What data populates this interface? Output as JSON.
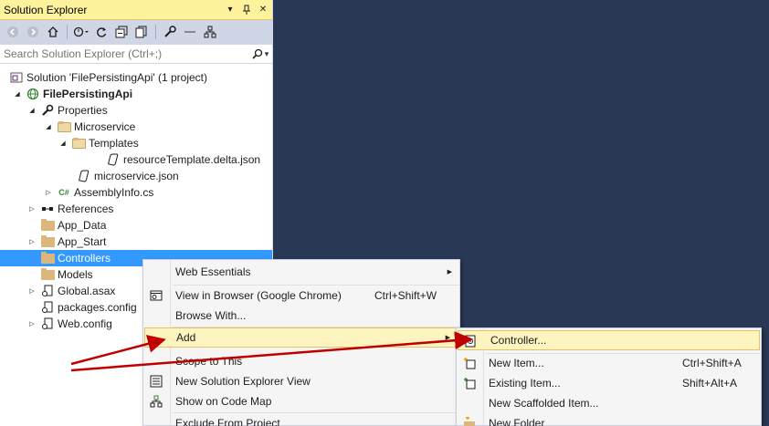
{
  "solution_explorer": {
    "title": "Solution Explorer",
    "title_buttons": [
      "dropdown-icon",
      "pin-icon",
      "close-icon"
    ],
    "toolbar_icons": [
      "back-icon",
      "forward-icon",
      "home-icon",
      "sync-history-icon",
      "refresh-icon",
      "collapse-all-icon",
      "show-all-files-icon",
      "properties-icon",
      "preview-icon",
      "code-map-icon"
    ],
    "search": {
      "placeholder": "Search Solution Explorer (Ctrl+;)"
    },
    "tree": [
      {
        "label": "Solution 'FilePersistingApi' (1 project)",
        "icon": "solution-icon",
        "expander": ""
      },
      {
        "label": "FilePersistingApi",
        "icon": "web-project-icon",
        "expander": "expanded",
        "bold": true
      },
      {
        "label": "Properties",
        "icon": "wrench-icon",
        "expander": "expanded"
      },
      {
        "label": "Microservice",
        "icon": "folder-open-icon",
        "expander": "expanded"
      },
      {
        "label": "Templates",
        "icon": "folder-open-icon",
        "expander": "expanded"
      },
      {
        "label": "resourceTemplate.delta.json",
        "icon": "json-file-icon",
        "expander": ""
      },
      {
        "label": "microservice.json",
        "icon": "json-file-icon",
        "expander": ""
      },
      {
        "label": "AssemblyInfo.cs",
        "icon": "csharp-file-icon",
        "expander": "collapsed"
      },
      {
        "label": "References",
        "icon": "references-icon",
        "expander": "collapsed"
      },
      {
        "label": "App_Data",
        "icon": "folder-icon",
        "expander": ""
      },
      {
        "label": "App_Start",
        "icon": "folder-icon",
        "expander": "collapsed"
      },
      {
        "label": "Controllers",
        "icon": "folder-icon",
        "expander": "",
        "selected": true
      },
      {
        "label": "Models",
        "icon": "folder-icon",
        "expander": ""
      },
      {
        "label": "Global.asax",
        "icon": "config-file-icon",
        "expander": "collapsed"
      },
      {
        "label": "packages.config",
        "icon": "config-file-icon",
        "expander": ""
      },
      {
        "label": "Web.config",
        "icon": "config-file-icon",
        "expander": "collapsed"
      }
    ]
  },
  "context_menu": {
    "items": [
      {
        "label": "Web Essentials",
        "shortcut": "",
        "submenu": true,
        "icon": ""
      },
      {
        "label": "View in Browser (Google Chrome)",
        "shortcut": "Ctrl+Shift+W",
        "submenu": false,
        "icon": "browser-icon"
      },
      {
        "label": "Browse With...",
        "shortcut": "",
        "submenu": false,
        "icon": ""
      },
      {
        "label": "Add",
        "shortcut": "",
        "submenu": true,
        "icon": "",
        "highlighted": true
      },
      {
        "label": "Scope to This",
        "shortcut": "",
        "submenu": false,
        "icon": ""
      },
      {
        "label": "New Solution Explorer View",
        "shortcut": "",
        "submenu": false,
        "icon": "new-view-icon"
      },
      {
        "label": "Show on Code Map",
        "shortcut": "",
        "submenu": false,
        "icon": "code-map-icon"
      },
      {
        "label": "Exclude From Project",
        "shortcut": "",
        "submenu": false,
        "icon": ""
      }
    ]
  },
  "add_submenu": {
    "items": [
      {
        "label": "Controller...",
        "shortcut": "",
        "icon": "controller-icon",
        "highlighted": true
      },
      {
        "label": "New Item...",
        "shortcut": "Ctrl+Shift+A",
        "icon": "new-item-icon"
      },
      {
        "label": "Existing Item...",
        "shortcut": "Shift+Alt+A",
        "icon": "existing-item-icon"
      },
      {
        "label": "New Scaffolded Item...",
        "shortcut": "",
        "icon": ""
      },
      {
        "label": "New Folder",
        "shortcut": "",
        "icon": "new-folder-icon"
      }
    ]
  },
  "annotation": {
    "arrow_color": "#c00000"
  },
  "colors": {
    "title_bar": "#fff29d",
    "selection": "#3399ff",
    "background": "#293955",
    "toolbar": "#cfd6e5",
    "menu_highlight": "#fdf4bf"
  }
}
